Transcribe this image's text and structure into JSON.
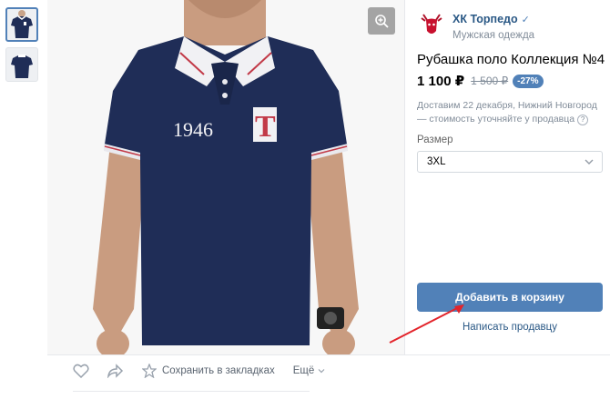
{
  "gallery": {
    "shirt_number": "1946",
    "shirt_letter": "T"
  },
  "shop": {
    "name": "ХК Торпедо",
    "category": "Мужская одежда",
    "verified_mark": "✓"
  },
  "product": {
    "title": "Рубашка поло Коллекция №4",
    "price": "1 100 ₽",
    "old_price": "1 500 ₽",
    "discount": "-27%",
    "delivery": "Доставим 22 декабря, Нижний Новгород — стоимость уточняйте у продавца",
    "help_icon": "?"
  },
  "size": {
    "label": "Размер",
    "selected": "3XL"
  },
  "buttons": {
    "add_to_cart": "Добавить в корзину",
    "message_seller": "Написать продавцу"
  },
  "actions": {
    "bookmark": "Сохранить в закладках",
    "more": "Ещё"
  },
  "colors": {
    "accent": "#5181b8",
    "link": "#2a5885",
    "shirt": "#1f2d57",
    "arrow": "#e3242b"
  }
}
